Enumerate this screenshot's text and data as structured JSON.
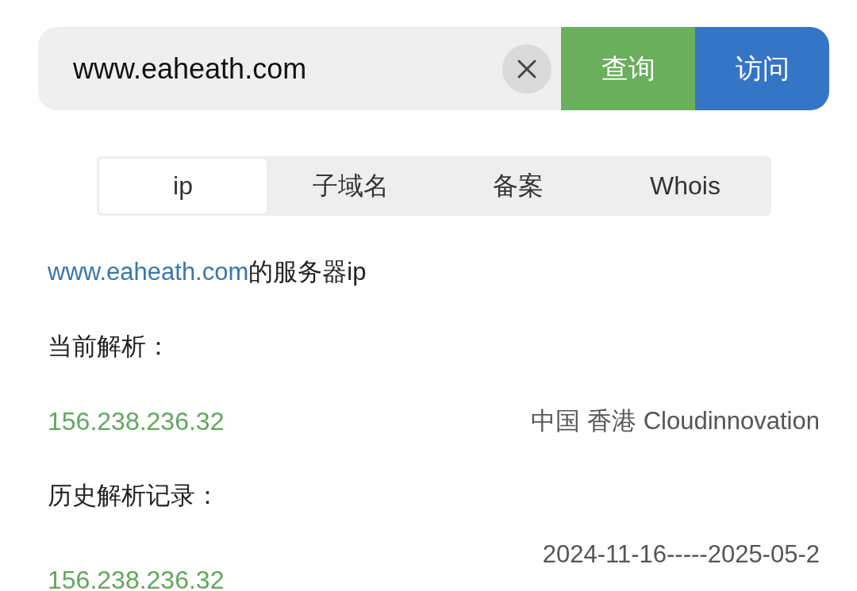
{
  "search": {
    "value": "www.eaheath.com"
  },
  "buttons": [
    {
      "label": "查询",
      "kind": "query"
    },
    {
      "label": "访问",
      "kind": "visit"
    }
  ],
  "tabs": [
    {
      "label": "ip",
      "selected": true
    },
    {
      "label": "子域名",
      "selected": false
    },
    {
      "label": "备案",
      "selected": false
    },
    {
      "label": "Whois",
      "selected": false
    }
  ],
  "heading": {
    "link": "www.eaheath.com",
    "suffix": "的服务器ip"
  },
  "current_label": "当前解析：",
  "current": [
    {
      "ip": "156.238.236.32",
      "location": "中国 香港 Cloudinnovation"
    }
  ],
  "history_label": "历史解析记录：",
  "history": [
    {
      "ip": "156.238.236.32",
      "period": "2024-11-16-----2025-05-2"
    }
  ]
}
